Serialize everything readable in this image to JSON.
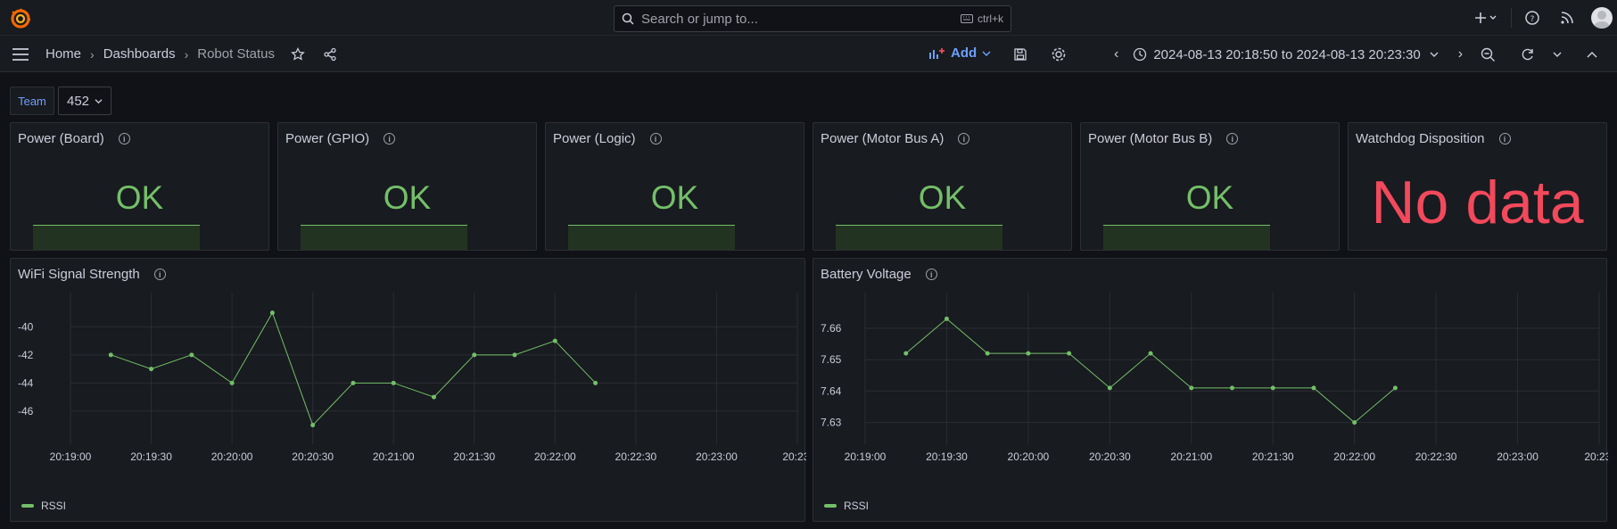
{
  "topbar": {
    "search_placeholder": "Search or jump to...",
    "search_shortcut": "ctrl+k",
    "icons": [
      "grafana-logo-icon",
      "plus-icon",
      "help-icon",
      "rss-icon",
      "avatar"
    ]
  },
  "navbar": {
    "breadcrumbs": [
      "Home",
      "Dashboards",
      "Robot Status"
    ],
    "add_label": "Add",
    "time_range": "2024-08-13 20:18:50 to 2024-08-13 20:23:30"
  },
  "variables": {
    "team_label": "Team",
    "team_value": "452"
  },
  "stat_panels": [
    {
      "title": "Power (Board)",
      "value": "OK"
    },
    {
      "title": "Power (GPIO)",
      "value": "OK"
    },
    {
      "title": "Power (Logic)",
      "value": "OK"
    },
    {
      "title": "Power (Motor Bus A)",
      "value": "OK"
    },
    {
      "title": "Power (Motor Bus B)",
      "value": "OK"
    },
    {
      "title": "Watchdog Disposition",
      "value": "No data"
    }
  ],
  "colors": {
    "ok": "#73bf69",
    "nodata": "#f2495c",
    "accent": "#6e9fff"
  },
  "wifi_panel": {
    "title": "WiFi Signal Strength",
    "legend": "RSSI"
  },
  "battery_panel": {
    "title": "Battery Voltage",
    "legend": "RSSI"
  },
  "chart_data": [
    {
      "type": "line",
      "title": "WiFi Signal Strength",
      "series": [
        {
          "name": "RSSI",
          "values": [
            -42,
            -43,
            -42,
            -44,
            -39,
            -47,
            -44,
            -44,
            -45,
            -42,
            -42,
            -41,
            -44
          ]
        }
      ],
      "x": [
        "20:19:15",
        "20:19:30",
        "20:19:45",
        "20:20:00",
        "20:20:15",
        "20:20:30",
        "20:20:45",
        "20:21:00",
        "20:21:15",
        "20:21:30",
        "20:21:45",
        "20:22:00",
        "20:22:15"
      ],
      "xticks": [
        "20:19:00",
        "20:19:30",
        "20:20:00",
        "20:20:30",
        "20:21:00",
        "20:21:30",
        "20:22:00",
        "20:22:30",
        "20:23:00",
        "20:23:"
      ],
      "yticks": [
        "-40",
        "-42",
        "-44",
        "-46"
      ],
      "ylim": [
        -47.6,
        -38.2
      ],
      "grid": true,
      "legend": "bottom-left"
    },
    {
      "type": "line",
      "title": "Battery Voltage",
      "series": [
        {
          "name": "RSSI",
          "values": [
            7.652,
            7.663,
            7.652,
            7.652,
            7.652,
            7.641,
            7.652,
            7.641,
            7.641,
            7.641,
            7.641,
            7.63,
            7.641
          ]
        }
      ],
      "x": [
        "20:19:15",
        "20:19:30",
        "20:19:45",
        "20:20:00",
        "20:20:15",
        "20:20:30",
        "20:20:45",
        "20:21:00",
        "20:21:15",
        "20:21:30",
        "20:21:45",
        "20:22:00",
        "20:22:15"
      ],
      "xticks": [
        "20:19:00",
        "20:19:30",
        "20:20:00",
        "20:20:30",
        "20:21:00",
        "20:21:30",
        "20:22:00",
        "20:22:30",
        "20:23:00",
        "20:23:"
      ],
      "yticks": [
        "7.66",
        "7.65",
        "7.64",
        "7.63"
      ],
      "ylim": [
        7.6265,
        7.6685
      ],
      "grid": true,
      "legend": "bottom-left"
    }
  ]
}
